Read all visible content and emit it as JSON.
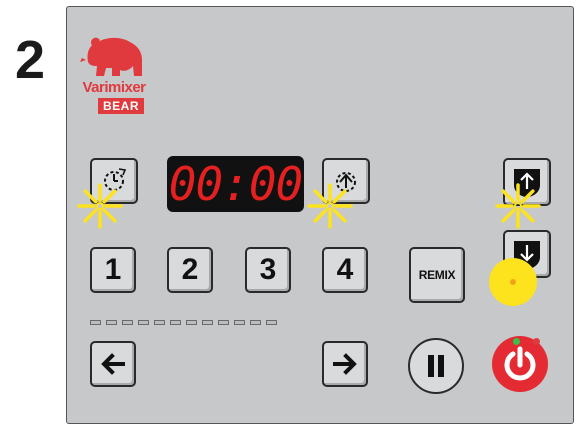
{
  "step": {
    "number": "2"
  },
  "brand": {
    "name": "Varimixer",
    "sub": "BEAR"
  },
  "display": {
    "time": "00:00"
  },
  "speed_buttons": [
    {
      "label": "1"
    },
    {
      "label": "2"
    },
    {
      "label": "3"
    },
    {
      "label": "4"
    }
  ],
  "remix": {
    "label": "REMIX"
  },
  "led_count": 12,
  "colors": {
    "panel": "#c7c8ca",
    "display_text": "#e42021",
    "brand_red": "#e03a3e",
    "power_red": "#e42b33",
    "spark_yellow": "#fde21e",
    "indicator_green": "#35c24a",
    "indicator_red": "#e03a3e"
  },
  "icons": {
    "timer_down": "timer-icon",
    "timer_up": "timer-up-icon",
    "bowl_up": "bowl-up-icon",
    "bowl_down": "bowl-down-icon",
    "left": "arrow-left-icon",
    "right": "arrow-right-icon",
    "pause": "pause-icon",
    "power": "power-icon"
  }
}
